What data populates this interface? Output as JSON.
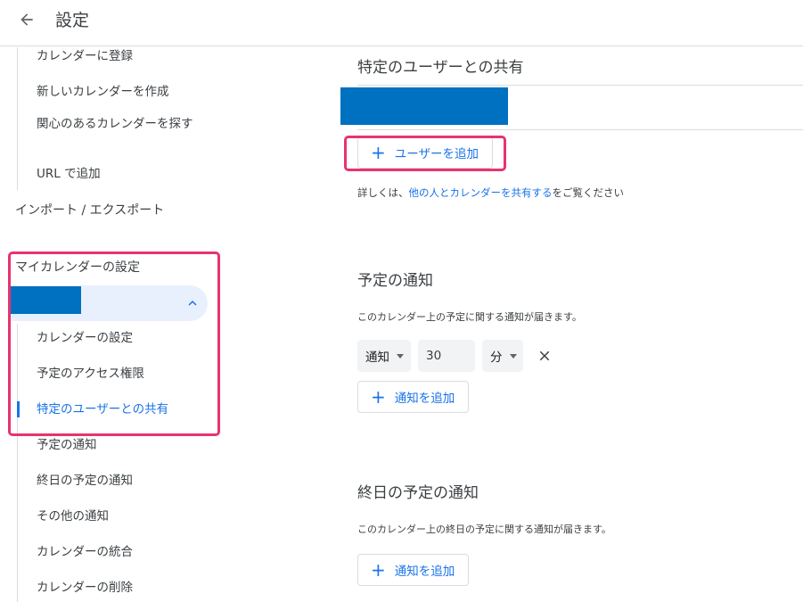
{
  "header": {
    "title": "設定"
  },
  "sidebar": {
    "sub_items_top": [
      "カレンダーに登録",
      "新しいカレンダーを作成",
      "関心のあるカレンダーを探す",
      "URL で追加"
    ],
    "import_export": "インポート / エクスポート",
    "my_calendars_title": "マイカレンダーの設定",
    "calendar_sub_items": [
      "カレンダーの設定",
      "予定のアクセス権限",
      "特定のユーザーとの共有",
      "予定の通知",
      "終日の予定の通知",
      "その他の通知",
      "カレンダーの統合",
      "カレンダーの削除"
    ]
  },
  "share_section": {
    "title": "特定のユーザーとの共有",
    "add_user_label": "ユーザーを追加",
    "help_prefix": "詳しくは、",
    "help_link": "他の人とカレンダーを共有する",
    "help_suffix": "をご覧ください"
  },
  "notify_section": {
    "title": "予定の通知",
    "description": "このカレンダー上の予定に関する通知が届きます。",
    "type_value": "通知",
    "amount_value": "30",
    "unit_value": "分",
    "add_label": "通知を追加"
  },
  "allday_section": {
    "title": "終日の予定の通知",
    "description": "このカレンダー上の終日の予定に関する通知が届きます。",
    "add_label": "通知を追加"
  },
  "colors": {
    "accent": "#1a73e8",
    "highlight": "#e8336d",
    "redaction": "#0070c0",
    "selected_bg": "#e8f0fe"
  }
}
